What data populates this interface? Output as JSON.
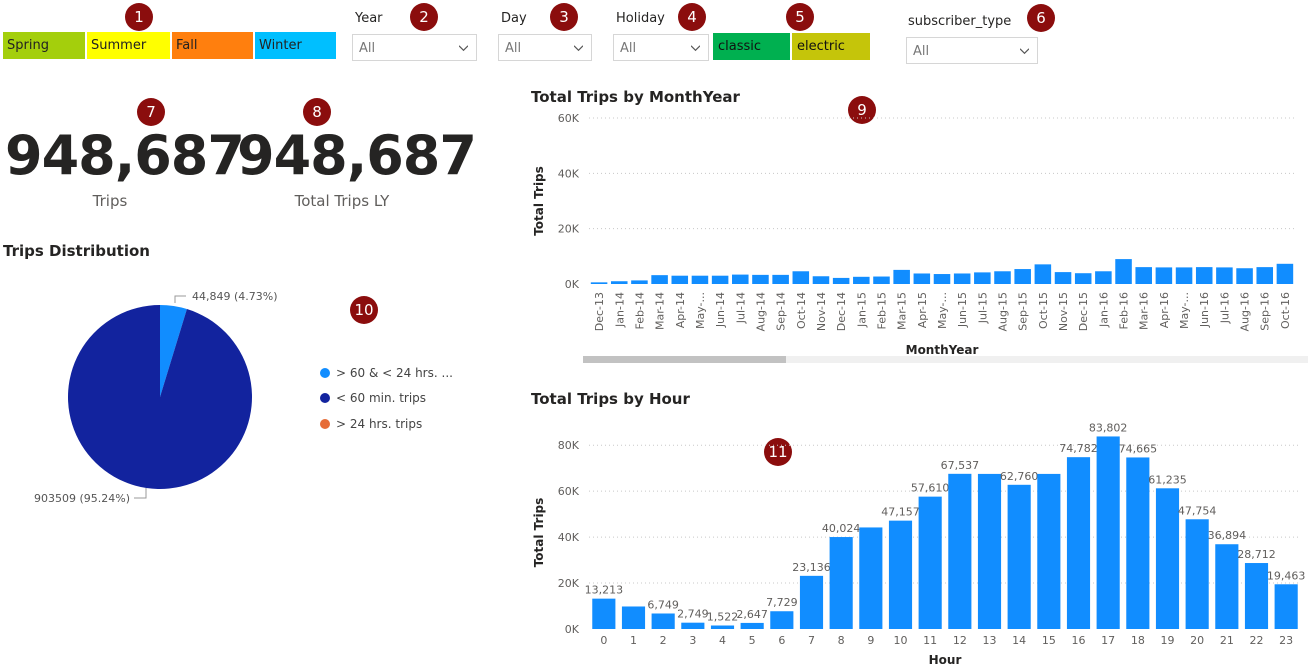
{
  "badges": [
    "1",
    "2",
    "3",
    "4",
    "5",
    "6",
    "7",
    "8",
    "9",
    "10",
    "11"
  ],
  "seasons": [
    {
      "label": "Spring",
      "color": "#a4cf0c"
    },
    {
      "label": "Summer",
      "color": "#ffff00"
    },
    {
      "label": "Fall",
      "color": "#ff7f0e"
    },
    {
      "label": "Winter",
      "color": "#00bfff"
    }
  ],
  "filters": {
    "year": {
      "label": "Year",
      "value": "All"
    },
    "day": {
      "label": "Day",
      "value": "All"
    },
    "holiday": {
      "label": "Holiday",
      "value": "All"
    },
    "subscriber_type": {
      "label": "subscriber_type",
      "value": "All"
    }
  },
  "bike_types": [
    {
      "label": "classic",
      "color": "#00b050"
    },
    {
      "label": "electric",
      "color": "#c5c50a"
    }
  ],
  "kpis": [
    {
      "value": "948,687",
      "label": "Trips"
    },
    {
      "value": "948,687",
      "label": "Total Trips LY"
    }
  ],
  "trips_distribution": {
    "title": "Trips Distribution",
    "slices": [
      {
        "name": "> 60 & < 24 hrs. ...",
        "value": 44849,
        "label": "44,849 (4.73%)",
        "color": "#118dff"
      },
      {
        "name": "< 60 min. trips",
        "value": 903509,
        "label": "903509 (95.24%)",
        "color": "#12239e"
      },
      {
        "name": "> 24 hrs. trips",
        "value": 0,
        "label": "",
        "color": "#e66c37"
      }
    ]
  },
  "chart_data": [
    {
      "type": "bar",
      "title": "Total Trips by MonthYear",
      "xlabel": "MonthYear",
      "ylabel": "Total Trips",
      "ylim": [
        0,
        60000
      ],
      "yticks": [
        "0K",
        "20K",
        "40K",
        "60K"
      ],
      "grid": true,
      "color": "#118dff",
      "categories": [
        "Dec-13",
        "Jan-14",
        "Feb-14",
        "Mar-14",
        "Apr-14",
        "May-...",
        "Jun-14",
        "Jul-14",
        "Aug-14",
        "Sep-14",
        "Oct-14",
        "Nov-14",
        "Dec-14",
        "Jan-15",
        "Feb-15",
        "Mar-15",
        "Apr-15",
        "May-...",
        "Jun-15",
        "Jul-15",
        "Aug-15",
        "Sep-15",
        "Oct-15",
        "Nov-15",
        "Dec-15",
        "Jan-16",
        "Feb-16",
        "Mar-16",
        "Apr-16",
        "May-...",
        "Jun-16",
        "Jul-16",
        "Aug-16",
        "Sep-16",
        "Oct-16"
      ],
      "values": [
        600,
        1000,
        1300,
        3200,
        3000,
        3000,
        3000,
        3400,
        3300,
        3300,
        4600,
        2800,
        2200,
        2600,
        2700,
        5100,
        3800,
        3600,
        3800,
        4200,
        4600,
        5400,
        7100,
        4300,
        3900,
        4600,
        9000,
        6100,
        6000,
        6000,
        6100,
        6000,
        5700,
        6100,
        7300
      ]
    },
    {
      "type": "bar",
      "title": "Total Trips by Hour",
      "xlabel": "Hour",
      "ylabel": "Total Trips",
      "ylim": [
        0,
        84000
      ],
      "yticks": [
        "0K",
        "20K",
        "40K",
        "60K",
        "80K"
      ],
      "grid": true,
      "color": "#118dff",
      "categories": [
        "0",
        "1",
        "2",
        "3",
        "4",
        "5",
        "6",
        "7",
        "8",
        "9",
        "10",
        "11",
        "12",
        "13",
        "14",
        "15",
        "16",
        "17",
        "18",
        "19",
        "20",
        "21",
        "22",
        "23"
      ],
      "values": [
        13213,
        9800,
        6749,
        2749,
        1522,
        2647,
        7729,
        23136,
        40024,
        44200,
        47157,
        57610,
        67537,
        67500,
        62760,
        67500,
        74782,
        83802,
        74665,
        61235,
        47754,
        36894,
        28712,
        19463
      ],
      "data_labels": [
        "13,213",
        "",
        "6,749",
        "2,749",
        "1,522",
        "2,647",
        "7,729",
        "23,136",
        "40,024",
        "",
        "47,157",
        "57,610",
        "67,537",
        "",
        "62,760",
        "",
        "74,782",
        "83,802",
        "74,665",
        "61,235",
        "47,754",
        "36,894",
        "28,712",
        "19,463"
      ]
    }
  ]
}
